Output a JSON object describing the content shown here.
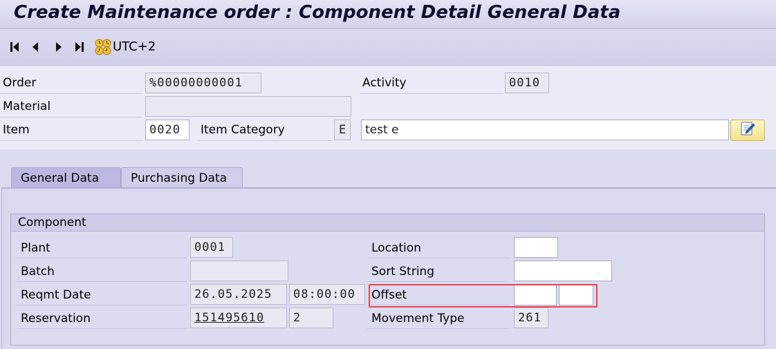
{
  "window": {
    "title": "Create Maintenance order : Component Detail General Data"
  },
  "toolbar": {
    "timezone_label": "UTC+2",
    "icons": [
      "first-page-icon",
      "previous-page-icon",
      "next-page-icon",
      "last-page-icon",
      "timezone-icon"
    ]
  },
  "header": {
    "order": {
      "label": "Order",
      "value": "%00000000001"
    },
    "activity": {
      "label": "Activity",
      "value": "0010"
    },
    "material": {
      "label": "Material",
      "value": ""
    },
    "item": {
      "label": "Item",
      "value": "0020"
    },
    "item_category": {
      "label": "Item Category",
      "value": "E"
    },
    "description": {
      "value": "test e"
    }
  },
  "tabs": [
    {
      "label": "General Data",
      "active": true
    },
    {
      "label": "Purchasing Data",
      "active": false
    }
  ],
  "component": {
    "title": "Component",
    "plant": {
      "label": "Plant",
      "value": "0001"
    },
    "batch": {
      "label": "Batch",
      "value": ""
    },
    "reqmt_date": {
      "label": "Reqmt Date",
      "date": "26.05.2025",
      "time": "08:00:00"
    },
    "reservation": {
      "label": "Reservation",
      "number": "151495610",
      "item": "2"
    },
    "location": {
      "label": "Location",
      "value": ""
    },
    "sort_string": {
      "label": "Sort String",
      "value": ""
    },
    "offset": {
      "label": "Offset",
      "value1": "",
      "value2": ""
    },
    "movement_type": {
      "label": "Movement Type",
      "value": "261"
    }
  },
  "colors": {
    "highlight": "#e8424d",
    "active_tab": "#b9b9e2",
    "background": "#dcdcf0"
  }
}
